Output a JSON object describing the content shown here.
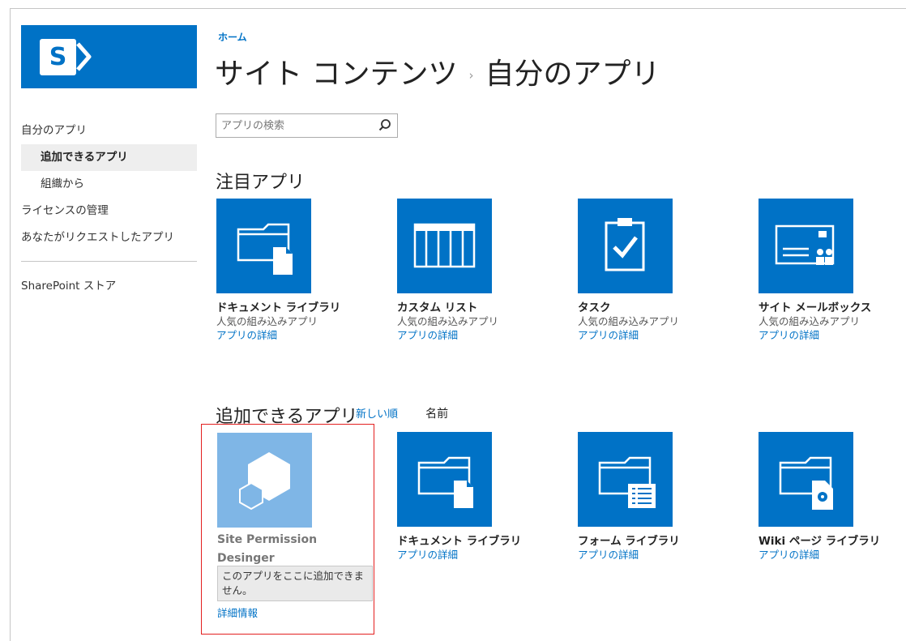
{
  "breadcrumb": {
    "home": "ホーム"
  },
  "title": {
    "parent": "サイト コンテンツ",
    "separator": "›",
    "current": "自分のアプリ"
  },
  "nav": {
    "items": [
      {
        "label": "自分のアプリ"
      },
      {
        "label": "追加できるアプリ"
      },
      {
        "label": "組織から"
      },
      {
        "label": "ライセンスの管理"
      },
      {
        "label": "あなたがリクエストしたアプリ"
      }
    ],
    "store": "SharePoint ストア"
  },
  "search": {
    "placeholder": "アプリの検索",
    "icon": "search-icon"
  },
  "featured": {
    "title": "注目アプリ",
    "tiles": [
      {
        "name": "ドキュメント ライブラリ",
        "desc": "人気の組み込みアプリ",
        "details": "アプリの詳細",
        "icon": "document-library-icon"
      },
      {
        "name": "カスタム リスト",
        "desc": "人気の組み込みアプリ",
        "details": "アプリの詳細",
        "icon": "custom-list-icon"
      },
      {
        "name": "タスク",
        "desc": "人気の組み込みアプリ",
        "details": "アプリの詳細",
        "icon": "tasks-icon"
      },
      {
        "name": "サイト メールボックス",
        "desc": "人気の組み込みアプリ",
        "details": "アプリの詳細",
        "icon": "site-mailbox-icon"
      }
    ]
  },
  "addable": {
    "title": "追加できるアプリ",
    "sort_newest": "新しい順",
    "sort_name": "名前",
    "disabled_app": {
      "name": "Site Permission Desinger",
      "message": "このアプリをここに追加できません。",
      "more": "詳細情報"
    },
    "tiles": [
      {
        "name": "ドキュメント ライブラリ",
        "details": "アプリの詳細",
        "icon": "document-library-icon"
      },
      {
        "name": "フォーム ライブラリ",
        "details": "アプリの詳細",
        "icon": "form-library-icon"
      },
      {
        "name": "Wiki ページ ライブラリ",
        "details": "アプリの詳細",
        "icon": "wiki-library-icon"
      }
    ]
  },
  "colors": {
    "tile_blue": "#0072c6",
    "tile_disabled": "#7fb6e6",
    "highlight_border": "#e32020"
  }
}
